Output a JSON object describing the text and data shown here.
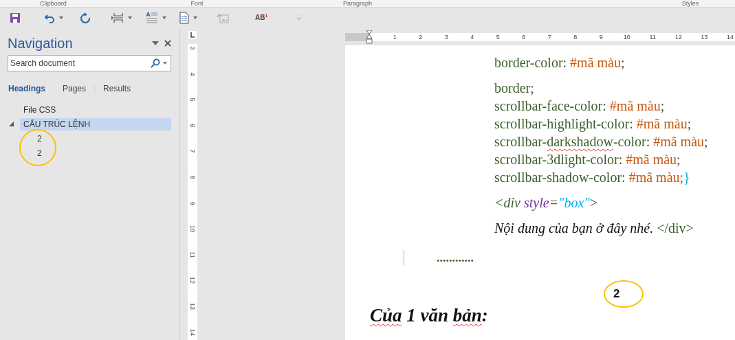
{
  "ribbon_groups": [
    "Clipboard",
    "Font",
    "Paragraph",
    "Styles"
  ],
  "toolbar": {
    "superscript_button": "AB$^{1}$"
  },
  "navigation": {
    "title": "Navigation",
    "search": {
      "placeholder": "Search document"
    },
    "tabs": [
      {
        "label": "Headings",
        "selected": true
      },
      {
        "label": "Pages",
        "selected": false
      },
      {
        "label": "Results",
        "selected": false
      }
    ],
    "tree": [
      {
        "label": "File CSS",
        "selected": false
      },
      {
        "label": "CẤU TRÚC LỆNH",
        "selected": true,
        "expanded": true,
        "children": [
          {
            "label": "2",
            "selected": false
          },
          {
            "label": "2",
            "selected": false
          }
        ]
      }
    ]
  },
  "rulers": {
    "horizontal": [
      "1",
      "2",
      "3",
      "4",
      "5",
      "6",
      "7",
      "8",
      "9",
      "10",
      "11",
      "12",
      "13",
      "14"
    ],
    "vertical": [
      "3",
      "4",
      "5",
      "6",
      "7",
      "8",
      "9",
      "10",
      "11",
      "12",
      "13",
      "14"
    ]
  },
  "document": {
    "blocks": [
      {
        "lines": [
          [
            {
              "text": "border-color: ",
              "kind": "code"
            },
            {
              "text": "#mã màu",
              "kind": "value"
            },
            {
              "text": ";",
              "kind": "code"
            }
          ]
        ]
      },
      {
        "lines": [
          [
            {
              "text": "border;",
              "kind": "code"
            }
          ],
          [
            {
              "text": "scrollbar-face-color: ",
              "kind": "code"
            },
            {
              "text": "#mã màu",
              "kind": "value"
            },
            {
              "text": ";",
              "kind": "code"
            }
          ],
          [
            {
              "text": "scrollbar-highlight-color: ",
              "kind": "code"
            },
            {
              "text": "#mã màu",
              "kind": "value"
            },
            {
              "text": ";",
              "kind": "code"
            }
          ],
          [
            {
              "text": "scrollbar-",
              "kind": "code"
            },
            {
              "text": "darkshadow",
              "kind": "code",
              "misspelled": true
            },
            {
              "text": "-color: ",
              "kind": "code"
            },
            {
              "text": "#mã màu",
              "kind": "value"
            },
            {
              "text": ";",
              "kind": "code"
            }
          ],
          [
            {
              "text": "scrollbar-3dlight-color: ",
              "kind": "code"
            },
            {
              "text": "#mã màu",
              "kind": "value"
            },
            {
              "text": ";",
              "kind": "code"
            }
          ],
          [
            {
              "text": "scrollbar-shadow-color: ",
              "kind": "code"
            },
            {
              "text": "#mã màu;",
              "kind": "value"
            },
            {
              "text": "}",
              "kind": "brace"
            }
          ]
        ]
      },
      {
        "lines": [
          [
            {
              "text": "<div ",
              "kind": "tag"
            },
            {
              "text": "style",
              "kind": "attr"
            },
            {
              "text": "=",
              "kind": "tag"
            },
            {
              "text": "\"box\"",
              "kind": "string"
            },
            {
              "text": ">",
              "kind": "code"
            }
          ]
        ]
      },
      {
        "lines": [
          [
            {
              "text": "Nội dung của bạn ở đây nhé. ",
              "kind": "prose"
            },
            {
              "text": "</div>",
              "kind": "code"
            }
          ]
        ]
      }
    ],
    "dots": "............",
    "annotation_mark": "2",
    "heading": [
      {
        "text": "Của",
        "misspelled": true
      },
      {
        "text": " 1 văn ",
        "misspelled": false
      },
      {
        "text": "bản",
        "misspelled": true
      },
      {
        "text": ":",
        "misspelled": false
      }
    ]
  }
}
